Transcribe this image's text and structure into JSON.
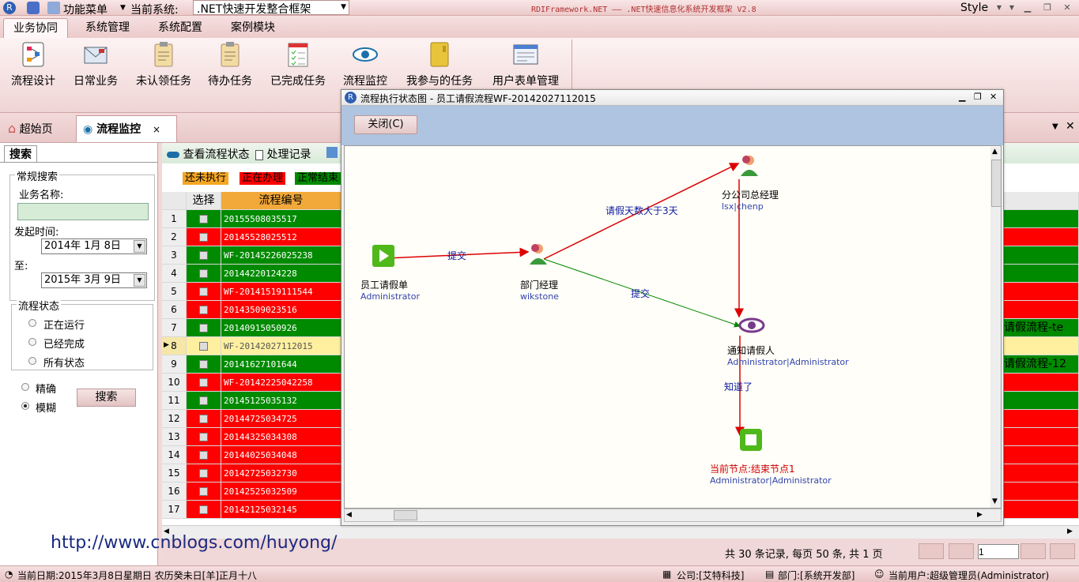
{
  "topbar": {
    "function_menu": "功能菜单",
    "current_system_label": "当前系统:",
    "current_system_value": ".NET快速开发整合框架",
    "app_title": "RDIFramework.NET —— .NET快速信息化系统开发框架 V2.8",
    "style_label": "Style"
  },
  "menu_tabs": [
    "业务协同",
    "系统管理",
    "系统配置",
    "案例模块"
  ],
  "ribbon": [
    "流程设计",
    "日常业务",
    "未认领任务",
    "待办任务",
    "已完成任务",
    "流程监控",
    "我参与的任务",
    "用户表单管理"
  ],
  "doc_tabs": {
    "home": "超始页",
    "monitor": "流程监控",
    "close": "×"
  },
  "search": {
    "tab": "搜索",
    "group_title": "常规搜索",
    "business_name_label": "业务名称:",
    "business_name_value": "",
    "start_time_label": "发起时间:",
    "start_date": "2014年  1月  8日",
    "to_label": "至:",
    "end_date": "2015年  3月  9日",
    "status_title": "流程状态",
    "status_options": [
      "正在运行",
      "已经完成",
      "所有状态"
    ],
    "mode_options": [
      "精确",
      "模糊"
    ],
    "search_button": "搜索"
  },
  "grid_toolbar": {
    "view_status": "查看流程状态",
    "records": "处理记录"
  },
  "legend": {
    "not_started": "还未执行",
    "in_progress": "正在办理",
    "finished": "正常结束"
  },
  "colors": {
    "green": "#008a00",
    "red": "#fe0000",
    "yellow": "#fff0a0",
    "orange": "#f5a623"
  },
  "grid": {
    "headers": {
      "select": "选择",
      "code": "流程编号"
    },
    "rows": [
      {
        "n": "1",
        "code": "20155508035517",
        "color": "green",
        "right": ""
      },
      {
        "n": "2",
        "code": "20145528025512",
        "color": "red",
        "right": ""
      },
      {
        "n": "3",
        "code": "WF-20145226025238",
        "color": "green",
        "right": ""
      },
      {
        "n": "4",
        "code": "20144220124228",
        "color": "green",
        "right": ""
      },
      {
        "n": "5",
        "code": "WF-20141519111544",
        "color": "red",
        "right": ""
      },
      {
        "n": "6",
        "code": "20143509023516",
        "color": "red",
        "right": ""
      },
      {
        "n": "7",
        "code": "20140915050926",
        "color": "green",
        "right": "请假流程-te"
      },
      {
        "n": "8",
        "code": "WF-20142027112015",
        "color": "yellow",
        "right": ""
      },
      {
        "n": "9",
        "code": "20141627101644",
        "color": "green",
        "right": "请假流程-12"
      },
      {
        "n": "10",
        "code": "WF-20142225042258",
        "color": "red",
        "right": ""
      },
      {
        "n": "11",
        "code": "20145125035132",
        "color": "green",
        "right": ""
      },
      {
        "n": "12",
        "code": "20144725034725",
        "color": "red",
        "right": ""
      },
      {
        "n": "13",
        "code": "20144325034308",
        "color": "red",
        "right": ""
      },
      {
        "n": "14",
        "code": "20144025034048",
        "color": "red",
        "right": ""
      },
      {
        "n": "15",
        "code": "20142725032730",
        "color": "red",
        "right": ""
      },
      {
        "n": "16",
        "code": "20142525032509",
        "color": "red",
        "right": ""
      },
      {
        "n": "17",
        "code": "20142125032145",
        "color": "red",
        "right": ""
      }
    ]
  },
  "pager": {
    "summary": "共  30  条记录, 每页  50  条, 共  1  页",
    "page": "1"
  },
  "watermark": "http://www.cnblogs.com/huyong/",
  "status": {
    "date": "当前日期:2015年3月8日星期日  农历癸未日[羊]正月十八",
    "company": "公司:[艾特科技]",
    "dept": "部门:[系统开发部]",
    "user": "当前用户:超级管理员(Administrator)"
  },
  "dialog": {
    "title": "流程执行状态图 - 员工请假流程WF-20142027112015",
    "close_button": "关闭(C)",
    "nodes": {
      "start": {
        "name": "员工请假单",
        "user": "Administrator"
      },
      "dept": {
        "name": "部门经理",
        "user": "wikstone"
      },
      "branch": {
        "name": "分公司总经理",
        "user": "lsx|chenp"
      },
      "notify": {
        "name": "通知请假人",
        "user": "Administrator|Administrator"
      },
      "end": {
        "name": "当前节点:结束节点1",
        "user": "Administrator|Administrator"
      }
    },
    "edges": {
      "submit1": "提交",
      "over3": "请假天数大于3天",
      "submit2": "提交",
      "known": "知道了"
    }
  }
}
